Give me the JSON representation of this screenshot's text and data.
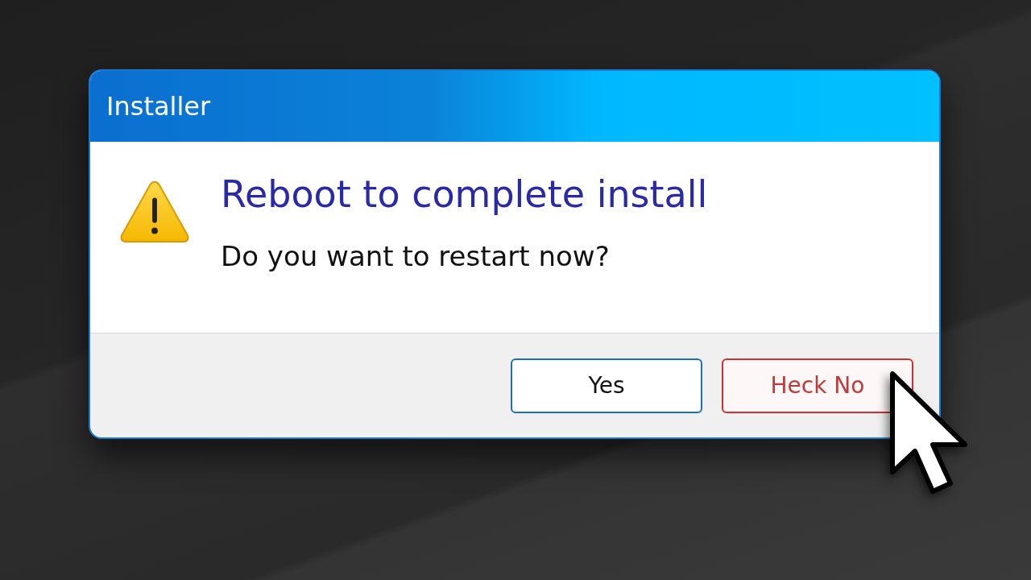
{
  "window": {
    "title": "Installer"
  },
  "message": {
    "heading": "Reboot to complete install",
    "text": "Do you want to restart now?"
  },
  "buttons": [
    {
      "label": "Yes",
      "kind": "accept"
    },
    {
      "label": "Heck No",
      "kind": "decline"
    }
  ]
}
